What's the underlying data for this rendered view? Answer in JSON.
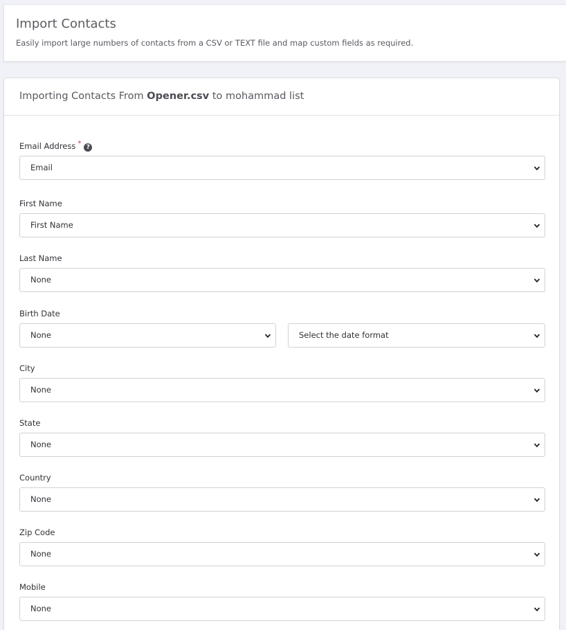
{
  "header": {
    "title": "Import Contacts",
    "subtitle": "Easily import large numbers of contacts from a CSV or TEXT file and map custom fields as required."
  },
  "card": {
    "title_prefix": "Importing Contacts From ",
    "file_name": "Opener.csv",
    "title_suffix": " to mohammad list"
  },
  "fields": {
    "email": {
      "label": "Email Address",
      "required": "*",
      "help": "?",
      "value": "Email"
    },
    "first_name": {
      "label": "First Name",
      "value": "First Name"
    },
    "last_name": {
      "label": "Last Name",
      "value": "None"
    },
    "birth_date": {
      "label": "Birth Date",
      "value": "None",
      "format_value": "Select the date format"
    },
    "city": {
      "label": "City",
      "value": "None"
    },
    "state": {
      "label": "State",
      "value": "None"
    },
    "country": {
      "label": "Country",
      "value": "None"
    },
    "zip_code": {
      "label": "Zip Code",
      "value": "None"
    },
    "mobile": {
      "label": "Mobile",
      "value": "None"
    }
  },
  "colors": {
    "background": "#f1f2f7",
    "card": "#ffffff",
    "required": "#e03131",
    "border": "#cfd1d6"
  },
  "icons": {
    "help": "question-circle-icon",
    "dropdown": "chevron-down-icon"
  }
}
